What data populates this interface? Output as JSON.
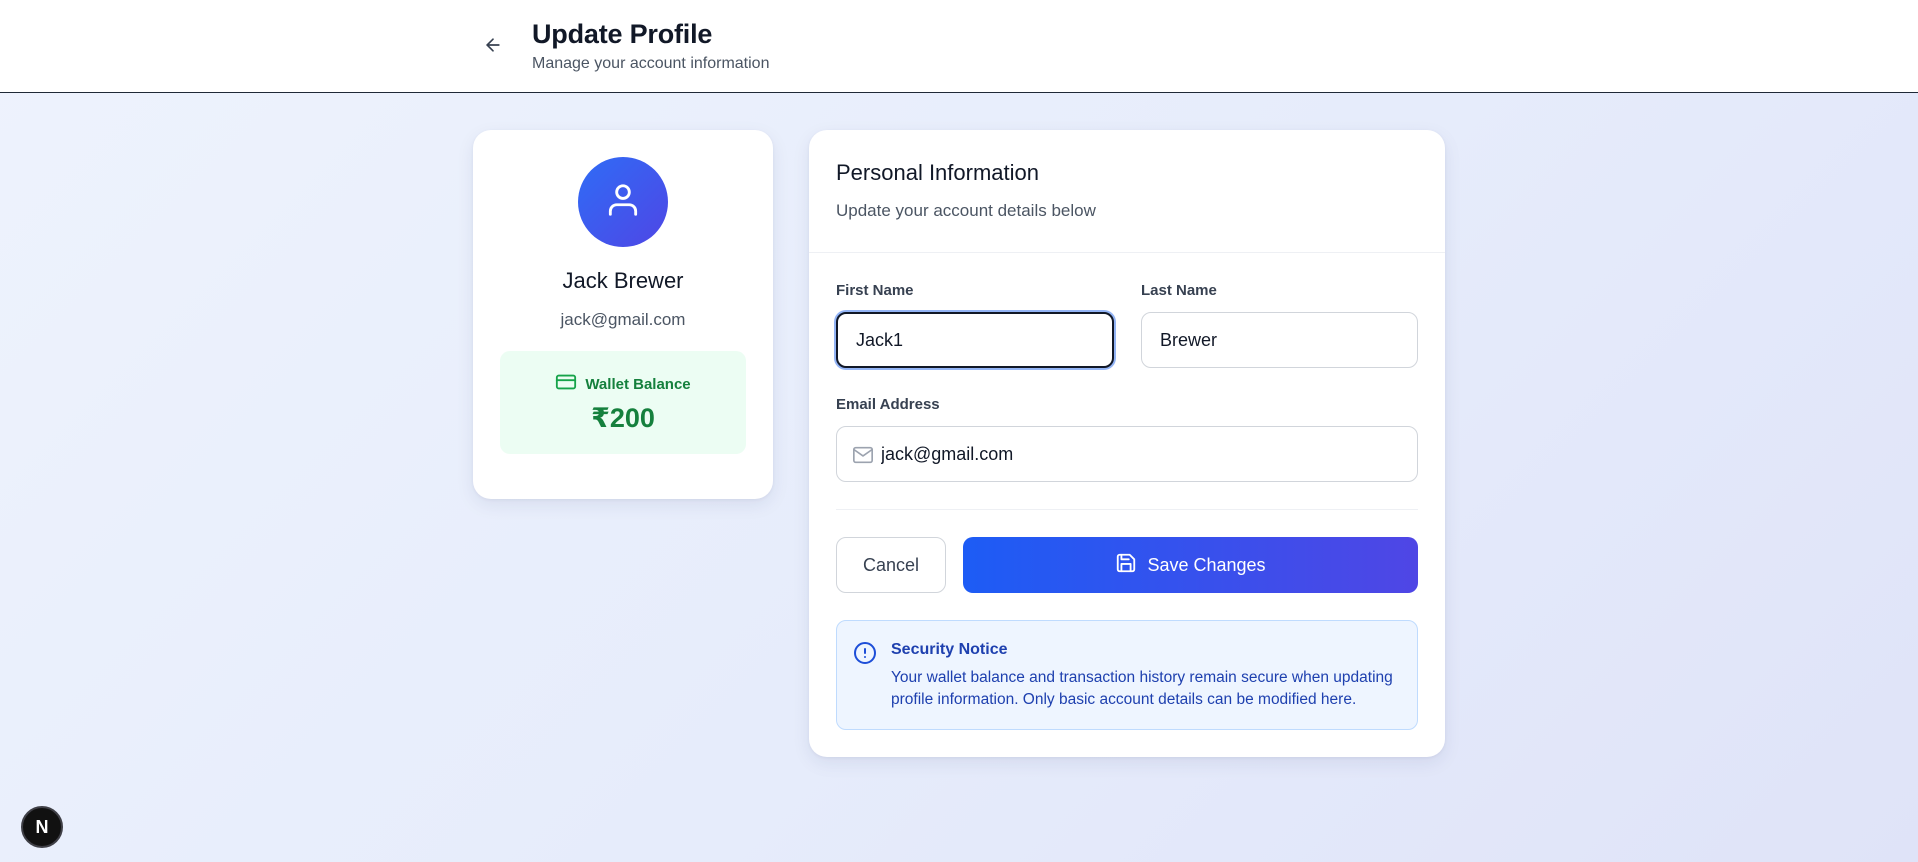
{
  "header": {
    "title": "Update Profile",
    "subtitle": "Manage your account information",
    "back_icon": "arrow-left-icon"
  },
  "profile": {
    "avatar_icon": "user-icon",
    "name": "Jack Brewer",
    "email": "jack@gmail.com",
    "wallet": {
      "icon": "credit-card-icon",
      "label": "Wallet Balance",
      "amount": "₹200",
      "color": "#15803d"
    }
  },
  "form": {
    "title": "Personal Information",
    "subtitle": "Update your account details below",
    "first_name": {
      "label": "First Name",
      "value": "Jack1"
    },
    "last_name": {
      "label": "Last Name",
      "value": "Brewer"
    },
    "email": {
      "label": "Email Address",
      "value": "jack@gmail.com",
      "icon": "mail-icon"
    },
    "cancel_label": "Cancel",
    "save_label": "Save Changes",
    "save_icon": "save-icon"
  },
  "notice": {
    "icon": "info-icon",
    "title": "Security Notice",
    "text": "Your wallet balance and transaction history remain secure when updating profile information. Only basic account details can be modified here."
  },
  "badge": {
    "label": "N"
  },
  "colors": {
    "accent_start": "#1d5cf5",
    "accent_end": "#4f46e5",
    "notice_text": "#1e40af"
  }
}
